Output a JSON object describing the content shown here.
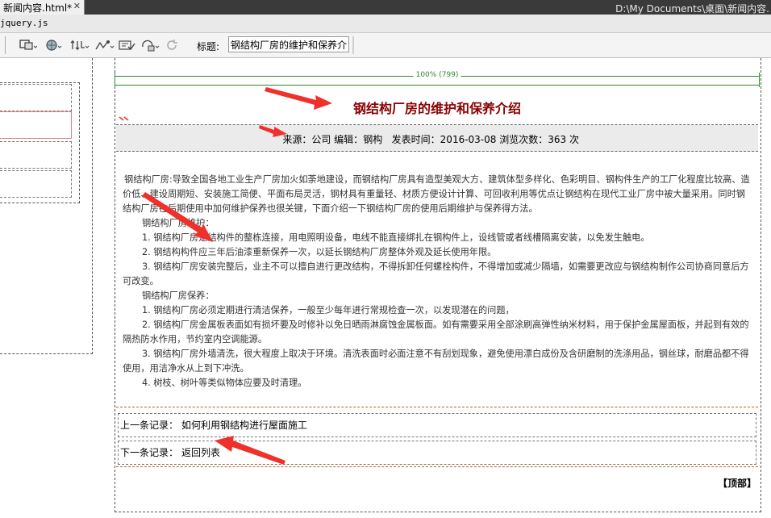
{
  "window": {
    "tab_label": "新闻内容.html*",
    "tab_close": "✕",
    "doc_path": "D:\\My Documents\\桌面\\新闻内容."
  },
  "related_files": {
    "file": "jquery.js"
  },
  "toolbar": {
    "title_label": "标题:",
    "title_value": "钢结构厂房的维护和保养介绍",
    "icons": [
      "multiscreen-icon",
      "globe-preview-icon",
      "file-manage-icon",
      "debug-icon",
      "validate-icon",
      "check-browser-icon",
      "refresh-icon"
    ]
  },
  "ruler": {
    "label": "100% (799)"
  },
  "article": {
    "title": "钢结构厂房的维护和保养介绍",
    "meta": {
      "source_label": "来源：",
      "source": "公司",
      "editor_label": "编辑：",
      "editor": "钢构",
      "date_label": "发表时间：",
      "date": "2016-03-08",
      "views_label": "浏览次数：",
      "views": "363 次"
    },
    "paragraphs": [
      "钢结构厂房:导致全国各地工业生产厂房加火如荼地建设，而钢结构厂房具有造型美观大方、建筑体型多样化、色彩明目、钢构件生产的工厂化程度比较高、造价低、建设周期短、安装施工简便、平面布局灵活，钢材具有重量轻、材质方便设计计算、可回收利用等优点让钢结构在现代工业厂房中被大量采用。同时钢结构厂房在后期使用中加何维护保养也很关键，下面介绍一下钢结构厂房的使用后期维护与保养得方法。",
      "钢结构厂房维护：",
      "1. 钢结构厂房是结构件的整栋连接，用电照明设备，电线不能直接绑扎在钢构件上，设线管或者线槽隔离安装，以免发生触电。",
      "2. 钢结构构件应三年后油漆重新保养一次，以延长钢结构厂房整体外观及延长使用年限。",
      "3. 钢结构厂房安装完整后，业主不可以擅自进行更改结构，不得拆卸任何螺栓构件，不得增加或减少隔墙，如需要更改应与钢结构制作公司协商同意后方可改变。",
      "钢结构厂房保养：",
      "1. 钢结构厂房必须定期进行清洁保养，一般至少每年进行常规检查一次，以发现潜在的问题，",
      "2. 钢结构厂房金属板表面如有损坏要及时修补以免日晒雨淋腐蚀金属板面。如有需要采用全部涂刷高弹性纳米材料，用于保护金属屋面板，并起到有效的隔热防水作用，节约室内空调能源。",
      "3. 钢结构厂房外墙清洗，很大程度上取决于环境。清洗表面时必面注意不有刮划现象，避免使用漂白成份及含研磨制的洗涤用品，钢丝球，耐磨品都不得使用，用洁净水从上到下冲洗。",
      "4. 树枝、树叶等类似物体应要及时清理。"
    ]
  },
  "navigation": {
    "prev_label": "上一条记录：",
    "prev_link": "如何利用钢结构进行屋面施工",
    "next_label": "下一条记录：",
    "next_link": "返回列表",
    "top_link": "【顶部】"
  },
  "colors": {
    "title": "#8b0000",
    "ruler": "#2c8a2c",
    "annotation_arrow": "#f0302a"
  }
}
